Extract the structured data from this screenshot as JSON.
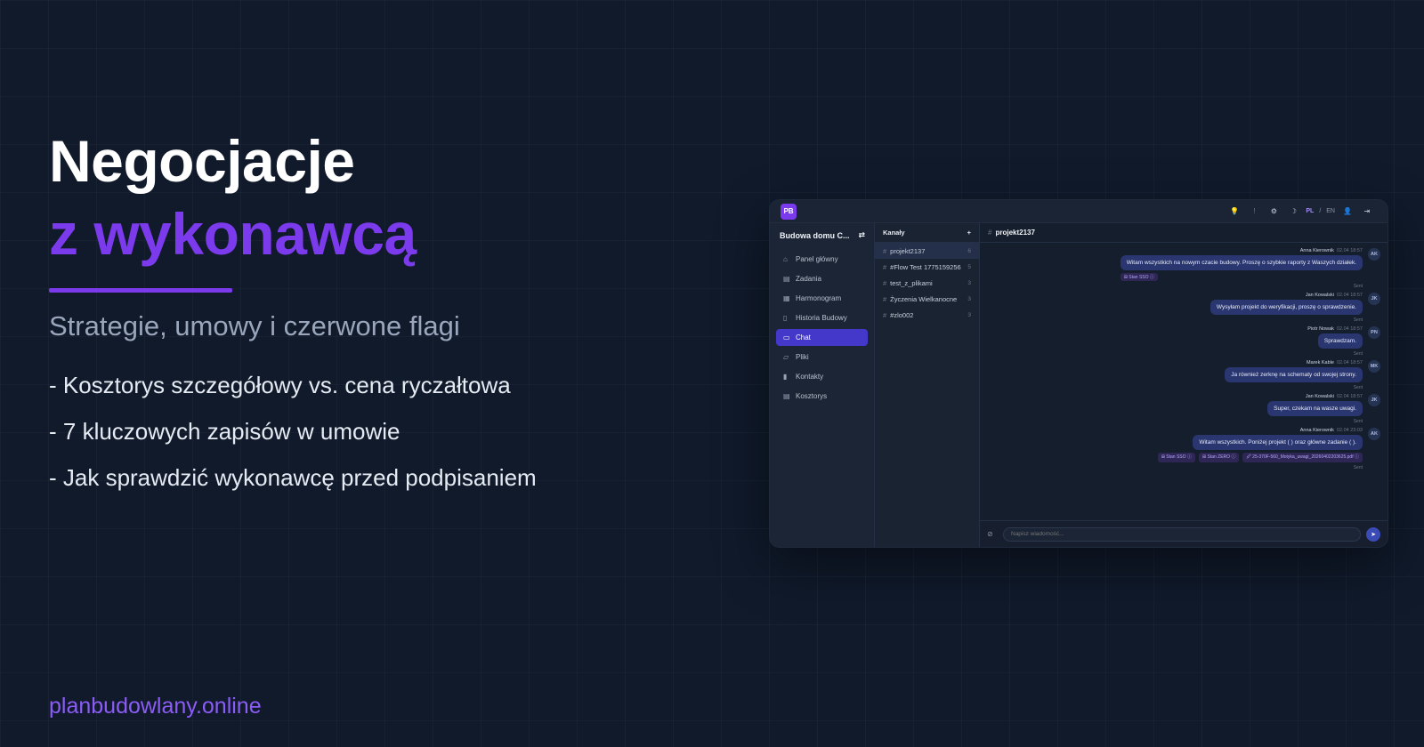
{
  "hero": {
    "title_line1": "Negocjacje",
    "title_line2": "z wykonawcą",
    "subtitle": "Strategie, umowy i czerwone flagi",
    "bullets": [
      "- Kosztorys szczegółowy vs. cena ryczałtowa",
      "- 7 kluczowych zapisów w umowie",
      "- Jak sprawdzić wykonawcę przed podpisaniem"
    ],
    "url": "planbudowlany.online"
  },
  "colors": {
    "accent": "#7c3aed",
    "background": "#101a2b",
    "active_nav": "#4338ca"
  },
  "app": {
    "logo_text": "PB",
    "topbar": {
      "icons": [
        "bulb-icon",
        "alert-icon",
        "settings-icon",
        "moon-icon",
        "user-icon",
        "logout-icon"
      ],
      "lang_pl": "PL",
      "lang_sep": "/",
      "lang_en": "EN"
    },
    "project_name": "Budowa domu C...",
    "nav": [
      {
        "label": "Panel główny",
        "icon": "home-icon"
      },
      {
        "label": "Zadania",
        "icon": "clipboard-icon"
      },
      {
        "label": "Harmonogram",
        "icon": "calendar-icon"
      },
      {
        "label": "Historia Budowy",
        "icon": "book-icon"
      },
      {
        "label": "Chat",
        "icon": "chat-icon",
        "active": true
      },
      {
        "label": "Pliki",
        "icon": "folder-icon"
      },
      {
        "label": "Kontakty",
        "icon": "contact-icon"
      },
      {
        "label": "Kosztorys",
        "icon": "receipt-icon"
      }
    ],
    "channels": {
      "header": "Kanały",
      "add": "+",
      "items": [
        {
          "name": "projekt2137",
          "count": "6",
          "active": true
        },
        {
          "name": "#Flow Test 1775159256",
          "count": "5"
        },
        {
          "name": "test_z_plikami",
          "count": "3"
        },
        {
          "name": "Życzenia Wielkanocne",
          "count": "3"
        },
        {
          "name": "#zlo002",
          "count": "3"
        }
      ]
    },
    "chat": {
      "channel": "projekt2137",
      "messages": [
        {
          "author": "Anna Kierownik",
          "time": "02.04 18:57",
          "avatar": "AK",
          "text": "Witam wszystkich na nowym czacie budowy. Proszę o szybkie raporty z Waszych działek.",
          "tags": [
            "⊞ Stan SSO ⓘ"
          ],
          "status": "Sent"
        },
        {
          "author": "Jan Kowalski",
          "time": "02.04 18:57",
          "avatar": "JK",
          "text": "Wysyłam projekt do weryfikacji, proszę o sprawdzenie.",
          "tags": [],
          "status": "Sent"
        },
        {
          "author": "Piotr Nowak",
          "time": "02.04 18:57",
          "avatar": "PN",
          "text": "Sprawdzam.",
          "tags": [],
          "status": "Sent"
        },
        {
          "author": "Marek Kable",
          "time": "02.04 18:57",
          "avatar": "MK",
          "text": "Ja również zerknę na schematy od swojej strony.",
          "tags": [],
          "status": "Sent"
        },
        {
          "author": "Jan Kowalski",
          "time": "02.04 18:57",
          "avatar": "JK",
          "text": "Super, czekam na wasze uwagi.",
          "tags": [],
          "status": "Sent"
        },
        {
          "author": "Anna Kierownik",
          "time": "02.04 23:03",
          "avatar": "AK",
          "text": "Witam wszystkich. Poniżej projekt ( ) oraz główne zadanie ( ).",
          "tags": [
            "⊞ Stan SSO ⓘ",
            "⊞ Stan ZERO ⓘ",
            "🖉 25-370F-560_Motyka_uwagi_20260402203625.pdf ⓘ"
          ],
          "status": "Sent"
        }
      ],
      "input_placeholder": "Napisz wiadomość..."
    }
  }
}
